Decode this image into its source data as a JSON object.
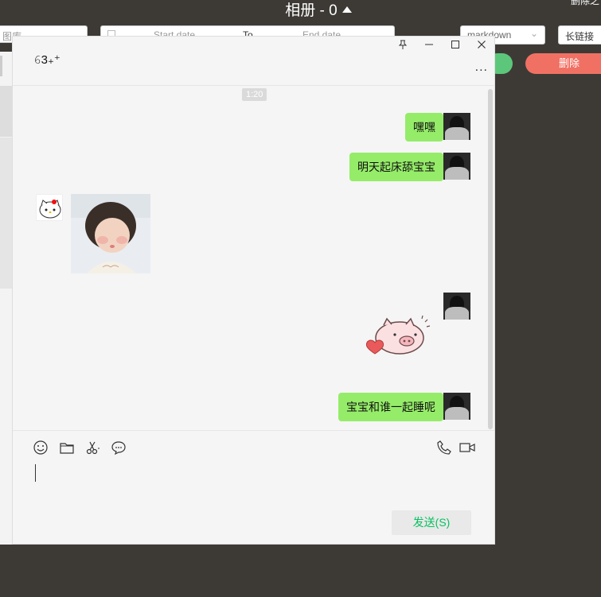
{
  "background_app": {
    "title": "相册 - 0",
    "top_right_text": "删除之",
    "category_select_partial": "图库",
    "date_range": {
      "start_placeholder": "Start date",
      "separator": "To",
      "end_placeholder": "End date"
    },
    "format_select": "markdown",
    "long_link_button": "长链接",
    "delete_button": "删除"
  },
  "chat": {
    "contact_name": "𝟼3₊⁺",
    "window_controls": {
      "pin": "pin-icon",
      "minimize": "minimize-icon",
      "maximize": "maximize-icon",
      "close": "close-icon"
    },
    "more_label": "...",
    "time_divider": "1:20",
    "messages": [
      {
        "sender": "me",
        "type": "text",
        "text": "嘿嘿"
      },
      {
        "sender": "me",
        "type": "text",
        "text": "明天起床舔宝宝"
      },
      {
        "sender": "other",
        "type": "image",
        "image": "baby-photo"
      },
      {
        "sender": "me",
        "type": "sticker",
        "image": "pig-heart-sticker"
      },
      {
        "sender": "me",
        "type": "text",
        "text": "宝宝和谁一起睡呢"
      }
    ],
    "toolbar": {
      "emoji": "emoji-icon",
      "file": "folder-icon",
      "screenshot": "scissors-icon",
      "chat_history": "chat-bubble-icon",
      "voice_call": "phone-icon",
      "video_call": "video-icon"
    },
    "send_button": "发送(S)"
  },
  "colors": {
    "bubble_me": "#95ec69",
    "send_text": "#07c160",
    "delete_button": "#f07163",
    "green_button": "#5cc77b"
  }
}
